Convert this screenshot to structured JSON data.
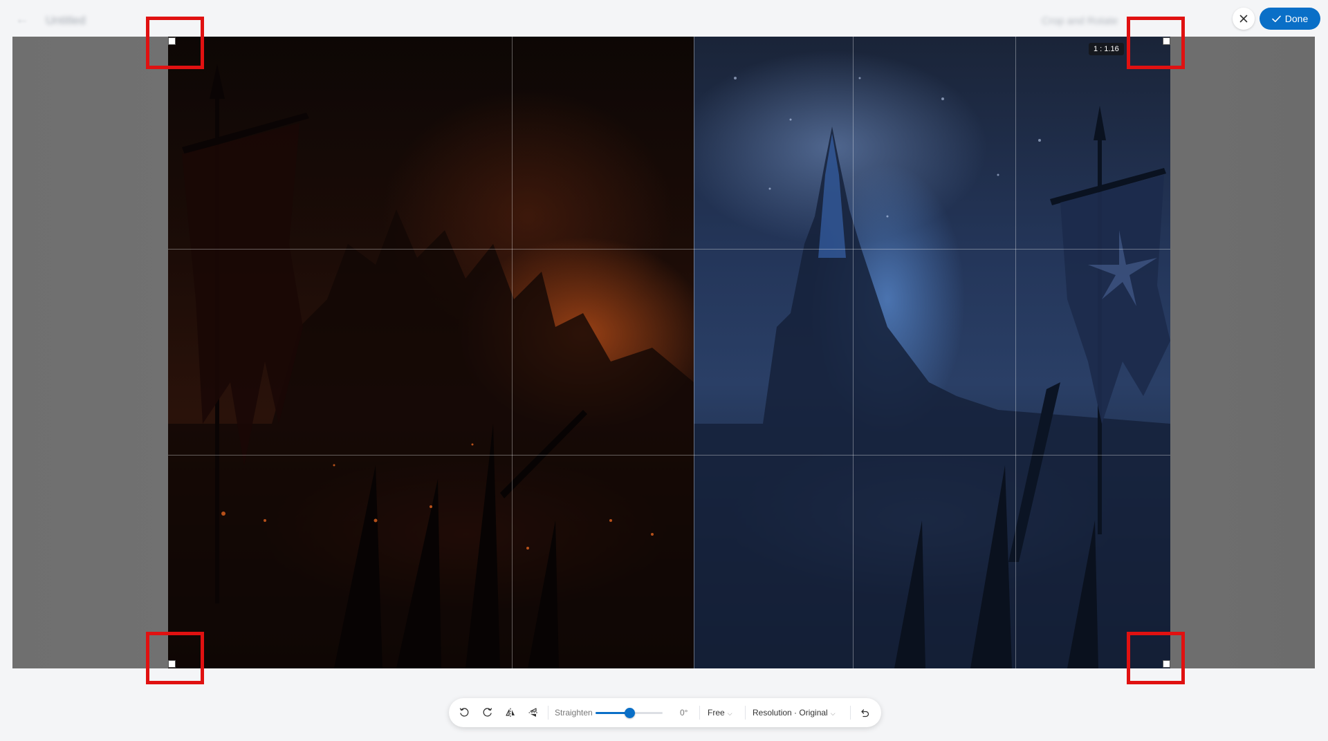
{
  "header": {
    "back_glyph": "←",
    "blurred_title": "Untitled",
    "blurred_right_text": "Crop and Rotate",
    "done_label": "Done",
    "accent_color": "#0a6fc7"
  },
  "canvas": {
    "aspect_ratio_label": "1 : 1.16",
    "highlight_color": "#e01111"
  },
  "toolbar": {
    "straighten_label": "Straighten",
    "straighten_value_label": "0°",
    "straighten_level": 0.5,
    "aspect_label": "Free",
    "resolution_label": "Resolution · Original",
    "icons": [
      "rotate-left-icon",
      "rotate-right-icon",
      "flip-horizontal-icon",
      "flip-vertical-icon",
      "reset-icon"
    ]
  }
}
